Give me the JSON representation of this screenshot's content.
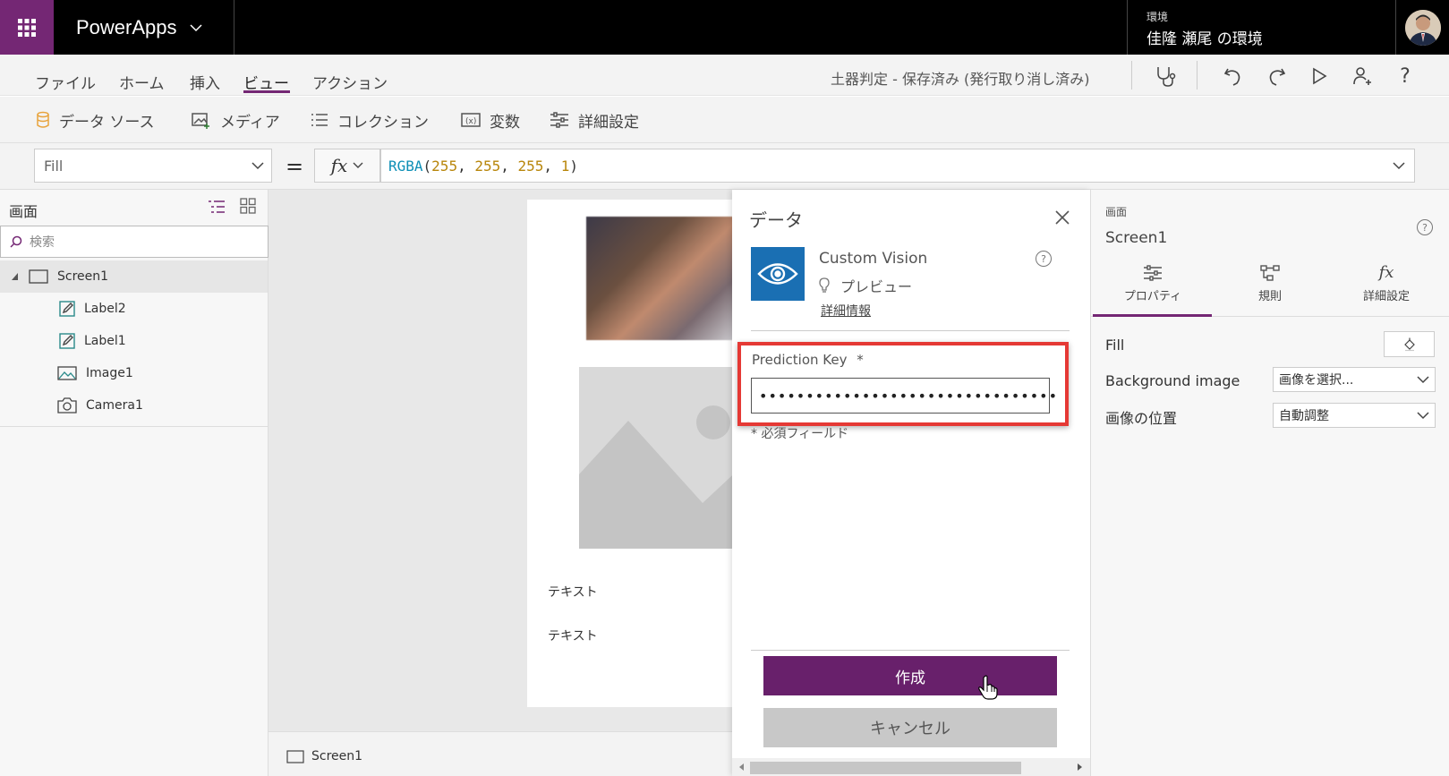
{
  "topbar": {
    "app_title": "PowerApps",
    "env_label": "環境",
    "env_name": "佳隆 瀬尾 の環境"
  },
  "menu": {
    "items": [
      "ファイル",
      "ホーム",
      "挿入",
      "ビュー",
      "アクション"
    ],
    "active": "ビュー",
    "doc_status": "土器判定 - 保存済み (発行取り消し済み)"
  },
  "ribbon": {
    "items": [
      "データ ソース",
      "メディア",
      "コレクション",
      "変数",
      "詳細設定"
    ]
  },
  "formula": {
    "property": "Fill",
    "equals": "=",
    "fx": "fx",
    "fn": "RGBA",
    "open": "(",
    "n1": "255",
    "n2": "255",
    "n3": "255",
    "n4": "1",
    "comma": ", ",
    "close": ")"
  },
  "tree": {
    "title": "画面",
    "search_placeholder": "検索",
    "screen": "Screen1",
    "children": [
      "Label2",
      "Label1",
      "Image1",
      "Camera1"
    ]
  },
  "canvas": {
    "label1": "テキスト",
    "label2": "テキスト",
    "screen_tab": "Screen1"
  },
  "data_panel": {
    "title": "データ",
    "connector_name": "Custom Vision",
    "preview": "プレビュー",
    "more_info": "詳細情報",
    "field_label": "Prediction Key",
    "required_mark": "*",
    "field_value": "••••••••••••••••••••••••••••••••",
    "required_note": "* 必須フィールド",
    "create_button": "作成",
    "cancel_button": "キャンセル"
  },
  "properties": {
    "section": "画面",
    "screen_name": "Screen1",
    "tabs": [
      "プロパティ",
      "規則",
      "詳細設定"
    ],
    "fill_label": "Fill",
    "bg_image_label": "Background image",
    "bg_image_value": "画像を選択...",
    "position_label": "画像の位置",
    "position_value": "自動調整"
  },
  "colors": {
    "brand": "#742774",
    "create_button": "#68206b",
    "highlight": "#e53935",
    "connector_icon": "#1a6fb3"
  }
}
